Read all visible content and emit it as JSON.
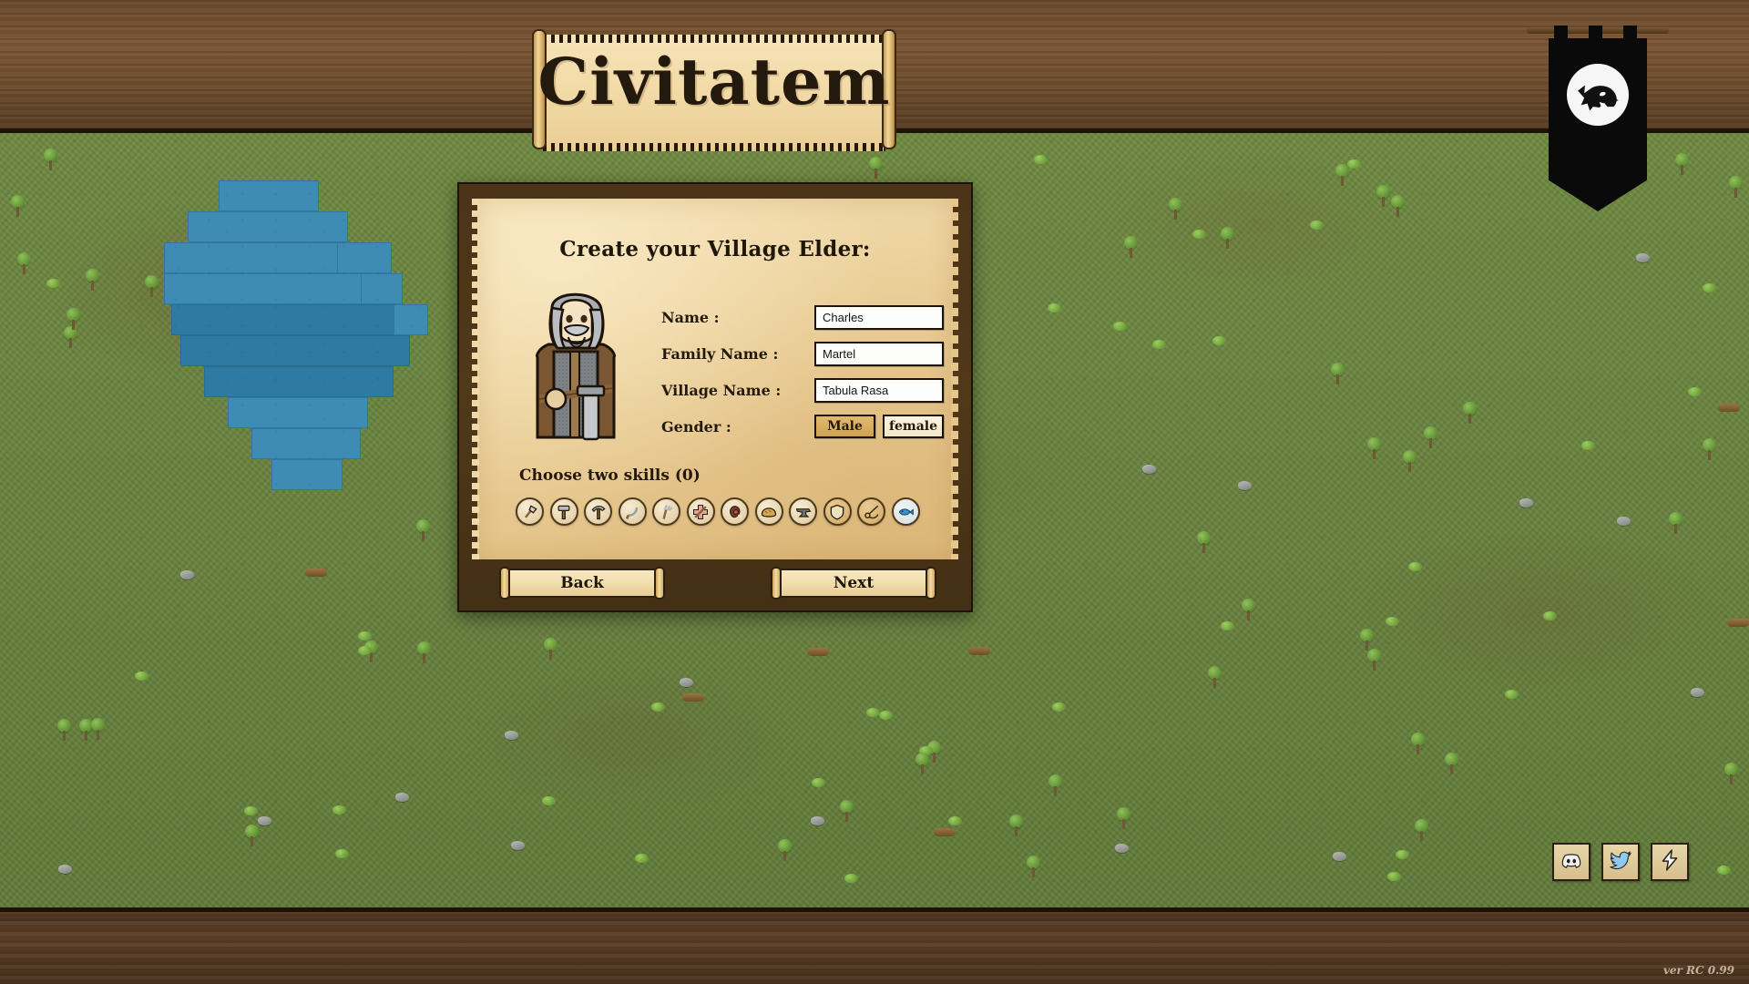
{
  "game": {
    "title": "Civitatem",
    "version": "ver RC 0.99"
  },
  "banner": {
    "emblem_icon": "wolf-head-icon"
  },
  "dialog": {
    "heading": "Create your Village Elder:",
    "portrait_icon": "village-elder-portrait",
    "fields": [
      {
        "label": "Name :",
        "value": "Charles",
        "name": "name"
      },
      {
        "label": "Family Name :",
        "value": "Martel",
        "name": "family-name"
      },
      {
        "label": "Village Name :",
        "value": "Tabula Rasa",
        "name": "village-name"
      }
    ],
    "gender": {
      "label": "Gender :",
      "options": [
        {
          "label": "Male",
          "selected": true
        },
        {
          "label": "female",
          "selected": false
        }
      ]
    },
    "skills": {
      "label": "Choose two skills (0)",
      "selected_count": 0,
      "required_count": 2,
      "items": [
        {
          "name": "axe-icon",
          "title": "Woodcutting"
        },
        {
          "name": "hammer-icon",
          "title": "Building"
        },
        {
          "name": "pickaxe-icon",
          "title": "Mining"
        },
        {
          "name": "sickle-icon",
          "title": "Harvesting"
        },
        {
          "name": "pitchfork-icon",
          "title": "Farming"
        },
        {
          "name": "medicine-icon",
          "title": "Healing"
        },
        {
          "name": "meat-icon",
          "title": "Hunting"
        },
        {
          "name": "bread-icon",
          "title": "Baking"
        },
        {
          "name": "anvil-icon",
          "title": "Smithing"
        },
        {
          "name": "shield-icon",
          "title": "Defense"
        },
        {
          "name": "needle-icon",
          "title": "Tailoring"
        },
        {
          "name": "fish-icon",
          "title": "Fishing"
        }
      ]
    },
    "buttons": {
      "back": "Back",
      "next": "Next"
    }
  },
  "social": [
    {
      "name": "discord-icon",
      "label": "Discord"
    },
    {
      "name": "twitter-icon",
      "label": "Twitter"
    },
    {
      "name": "lightning-icon",
      "label": "News"
    }
  ],
  "colors": {
    "parchment": "#ecd09a",
    "wood_frame": "#4b3418",
    "grass": "#6a8340",
    "water": "#3e8bb4",
    "selected_gold": "#e3b96d",
    "banner_black": "#0a0a0a"
  }
}
